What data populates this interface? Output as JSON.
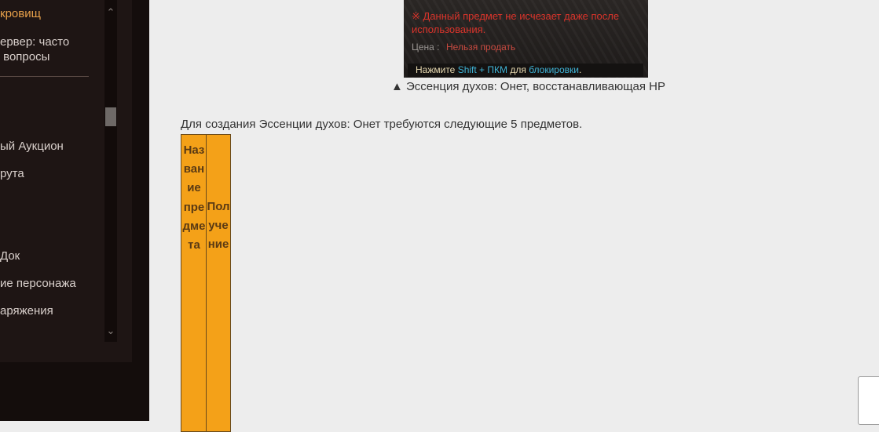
{
  "sidebar": {
    "items": [
      {
        "label": "кровищ",
        "active": true
      },
      {
        "label": "ервер: часто\n вопросы"
      },
      {
        "label": "ый Аукцион"
      },
      {
        "label": "рута"
      },
      {
        "label": "Док"
      },
      {
        "label": "ие персонажа"
      },
      {
        "label": "аряжения"
      }
    ]
  },
  "tooltip": {
    "warning": "※ Данный предмет не исчезает даже после использования.",
    "price_label": "Цена :",
    "price_value": "Нельзя продать",
    "hint_prefix": "Нажмите ",
    "hint_keys": "Shift + ПКМ",
    "hint_middle": " для ",
    "hint_action": "блокировки",
    "hint_suffix": "."
  },
  "caption": "▲ Эссенция духов: Онет, восстанавливающая HP",
  "intro": "Для создания Эссенции духов: Онет требуются следующие 5 предметов.",
  "table": {
    "headers": [
      "Название предмета",
      "Получение"
    ]
  },
  "colors": {
    "table_bg": "#f4a118",
    "sidebar_bg": "#1e1514",
    "active_item": "#e7a04a"
  }
}
